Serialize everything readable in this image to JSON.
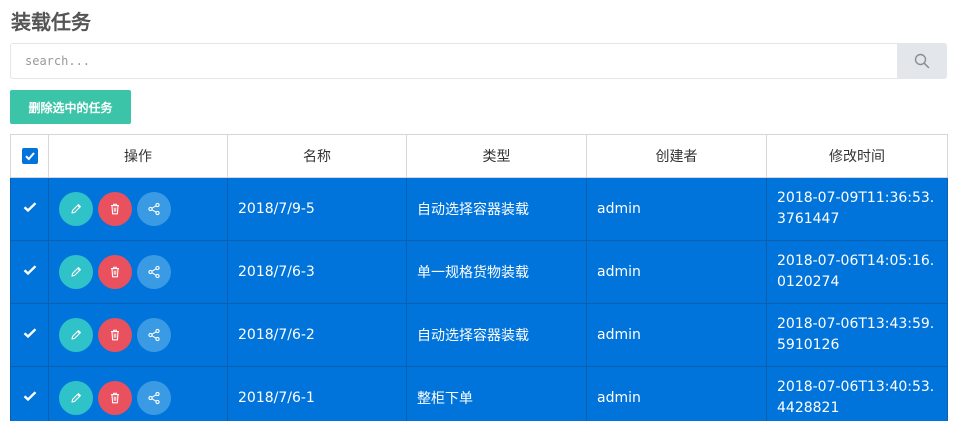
{
  "page": {
    "title": "装载任务"
  },
  "search": {
    "placeholder": "search...",
    "value": ""
  },
  "toolbar": {
    "delete_selected_label": "删除选中的任务"
  },
  "table": {
    "headers": {
      "actions": "操作",
      "name": "名称",
      "type": "类型",
      "creator": "创建者",
      "modified": "修改时间"
    },
    "all_selected": true,
    "rows": [
      {
        "selected": true,
        "name": "2018/7/9-5",
        "type": "自动选择容器装载",
        "creator": "admin",
        "modified": "2018-07-09T11:36:53.3761447"
      },
      {
        "selected": true,
        "name": "2018/7/6-3",
        "type": "单一规格货物装载",
        "creator": "admin",
        "modified": "2018-07-06T14:05:16.0120274"
      },
      {
        "selected": true,
        "name": "2018/7/6-2",
        "type": "自动选择容器装载",
        "creator": "admin",
        "modified": "2018-07-06T13:43:59.5910126"
      },
      {
        "selected": true,
        "name": "2018/7/6-1",
        "type": "整柜下单",
        "creator": "admin",
        "modified": "2018-07-06T13:40:53.4428821"
      }
    ]
  },
  "icons": {
    "search": "search-icon",
    "edit": "pencil-icon",
    "delete": "trash-icon",
    "share": "share-icon",
    "check": "checkmark-icon"
  },
  "colors": {
    "selected_row": "#0074db",
    "delete_button": "#3bc4a8",
    "edit": "#2fc3c9",
    "remove": "#e9515f",
    "share": "#3a9be4"
  }
}
